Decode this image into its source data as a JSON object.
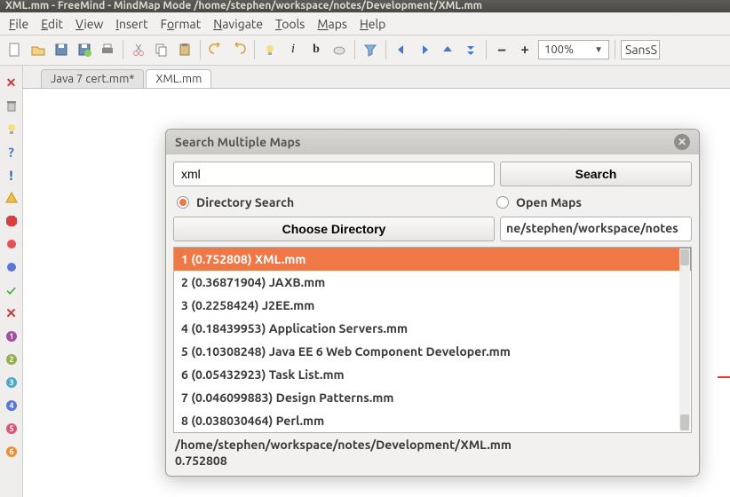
{
  "title": "XML.mm - FreeMind - MindMap Mode /home/stephen/workspace/notes/Development/XML.mm",
  "menu": [
    "File",
    "Edit",
    "View",
    "Insert",
    "Format",
    "Navigate",
    "Tools",
    "Maps",
    "Help"
  ],
  "toolbar": {
    "zoom": "100%",
    "font_trunc": "SansS"
  },
  "tabs": [
    {
      "label": "Java 7 cert.mm*",
      "active": false
    },
    {
      "label": "XML.mm",
      "active": true
    }
  ],
  "dialog": {
    "title": "Search Multiple Maps",
    "search_value": "xml",
    "search_label": "Search",
    "radio_dir": "Directory Search",
    "radio_open": "Open Maps",
    "choose_label": "Choose Directory",
    "dir_value": "ne/stephen/workspace/notes",
    "results": [
      "1 (0.752808) XML.mm",
      "2 (0.36871904) JAXB.mm",
      "3 (0.2258424) J2EE.mm",
      "4 (0.18439953) Application Servers.mm",
      "5 (0.10308248) Java EE 6 Web Component Developer.mm",
      "6 (0.05432923) Task List.mm",
      "7 (0.046099883) Design Patterns.mm",
      "8 (0.038030464) Perl.mm"
    ],
    "status_path": "/home/stephen/workspace/notes/Development/XML.mm",
    "status_score": "0.752808"
  }
}
